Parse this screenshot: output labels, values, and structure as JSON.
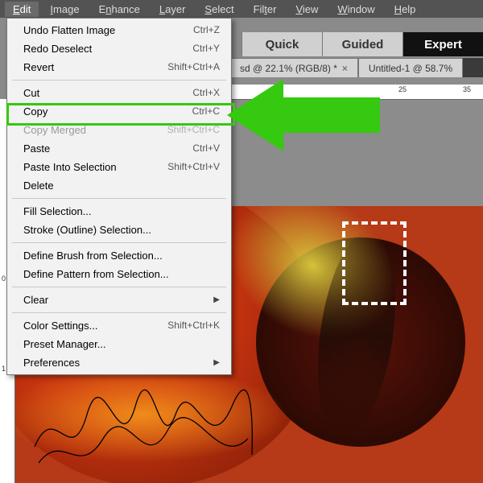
{
  "menubar": {
    "items": [
      {
        "label": "Edit",
        "u": "E"
      },
      {
        "label": "Image",
        "u": "I"
      },
      {
        "label": "Enhance",
        "u": "n"
      },
      {
        "label": "Layer",
        "u": "L"
      },
      {
        "label": "Select",
        "u": "S"
      },
      {
        "label": "Filter",
        "u": "t"
      },
      {
        "label": "View",
        "u": "V"
      },
      {
        "label": "Window",
        "u": "W"
      },
      {
        "label": "Help",
        "u": "H"
      }
    ]
  },
  "modes": {
    "quick": "Quick",
    "guided": "Guided",
    "expert": "Expert"
  },
  "doctabs": [
    {
      "label": "sd @ 22.1% (RGB/8) *"
    },
    {
      "label": "Untitled-1 @ 58.7%"
    }
  ],
  "ruler": {
    "h": [
      "25",
      "35"
    ],
    "v": [
      "0",
      "1"
    ]
  },
  "menu": {
    "sections": [
      [
        {
          "label": "Undo Flatten Image",
          "shortcut": "Ctrl+Z"
        },
        {
          "label": "Redo Deselect",
          "shortcut": "Ctrl+Y"
        },
        {
          "label": "Revert",
          "shortcut": "Shift+Ctrl+A"
        }
      ],
      [
        {
          "label": "Cut",
          "shortcut": "Ctrl+X"
        },
        {
          "label": "Copy",
          "shortcut": "Ctrl+C",
          "hl": true
        },
        {
          "label": "Copy Merged",
          "shortcut": "Shift+Ctrl+C",
          "disabled": true
        },
        {
          "label": "Paste",
          "shortcut": "Ctrl+V"
        },
        {
          "label": "Paste Into Selection",
          "shortcut": "Shift+Ctrl+V"
        },
        {
          "label": "Delete",
          "shortcut": ""
        }
      ],
      [
        {
          "label": "Fill Selection...",
          "shortcut": ""
        },
        {
          "label": "Stroke (Outline) Selection...",
          "shortcut": ""
        }
      ],
      [
        {
          "label": "Define Brush from Selection...",
          "shortcut": ""
        },
        {
          "label": "Define Pattern from Selection...",
          "shortcut": ""
        }
      ],
      [
        {
          "label": "Clear",
          "shortcut": "",
          "submenu": true
        }
      ],
      [
        {
          "label": "Color Settings...",
          "shortcut": "Shift+Ctrl+K"
        },
        {
          "label": "Preset Manager...",
          "shortcut": ""
        },
        {
          "label": "Preferences",
          "shortcut": "",
          "submenu": true
        }
      ]
    ]
  }
}
